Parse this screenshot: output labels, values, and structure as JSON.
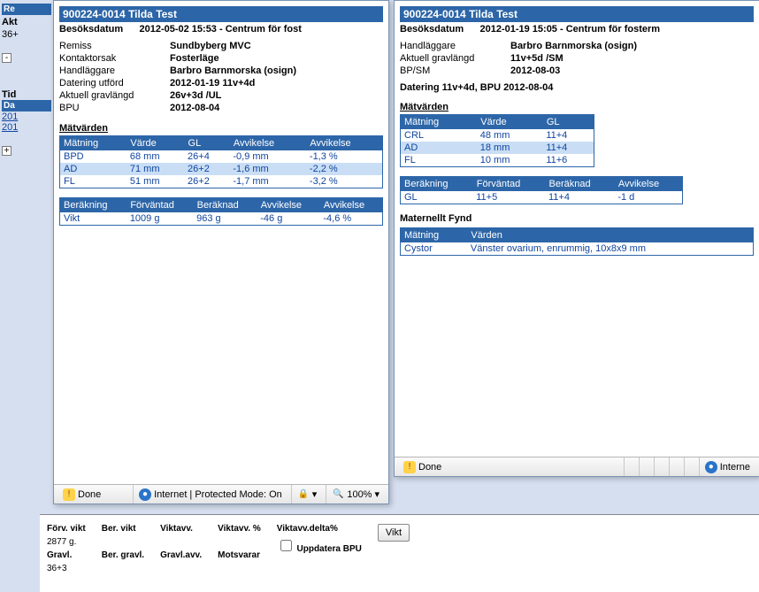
{
  "bg": {
    "re_label": "Re",
    "akt_label": "Akt",
    "akt_value": "36+",
    "tid_label": "Tid",
    "dat_label": "Da",
    "dates": [
      "201",
      "201"
    ]
  },
  "bottom": {
    "forv_vikt_lbl": "Förv. vikt",
    "forv_vikt_val": "2877 g.",
    "ber_vikt_lbl": "Ber. vikt",
    "viktavv_lbl": "Viktavv.",
    "viktavv_pct_lbl": "Viktavv. %",
    "viktavv_delta_lbl": "Viktavv.delta%",
    "gravl_lbl": "Gravl.",
    "gravl_val": "36+3",
    "ber_gravl_lbl": "Ber. gravl.",
    "gravlavv_lbl": "Gravl.avv.",
    "motsvarar_lbl": "Motsvarar",
    "uppdat_lbl": "Uppdatera BPU",
    "vikt_btn": "Vikt"
  },
  "left": {
    "title": "900224-0014 Tilda Test",
    "sub": "Besöksdatum      2012-05-02 15:53 - Centrum för fost",
    "kv": {
      "remiss_l": "Remiss",
      "remiss_v": "Sundbyberg MVC",
      "kontakt_l": "Kontaktorsak",
      "kontakt_v": "Fosterläge",
      "handl_l": "Handläggare",
      "handl_v": "Barbro Barnmorska (osign)",
      "datering_l": "Datering utförd",
      "datering_v": "2012-01-19 11v+4d",
      "akt_l": "Aktuell gravlängd",
      "akt_v": "26v+3d /UL",
      "bpu_l": "BPU",
      "bpu_v": "2012-08-04"
    },
    "matv_label": "Mätvärden",
    "matv_headers": [
      "Mätning",
      "Värde",
      "GL",
      "Avvikelse",
      "Avvikelse"
    ],
    "matv_rows": [
      {
        "m": "BPD",
        "v": "68 mm",
        "g": "26+4",
        "a": "-0,9 mm",
        "p": "-1,3 %",
        "sel": false
      },
      {
        "m": "AD",
        "v": "71 mm",
        "g": "26+2",
        "a": "-1,6 mm",
        "p": "-2,2 %",
        "sel": true
      },
      {
        "m": "FL",
        "v": "51 mm",
        "g": "26+2",
        "a": "-1,7 mm",
        "p": "-3,2 %",
        "sel": false
      }
    ],
    "calc_headers": [
      "Beräkning",
      "Förväntad",
      "Beräknad",
      "Avvikelse",
      "Avvikelse"
    ],
    "calc_rows": [
      {
        "b": "Vikt",
        "f": "1009 g",
        "c": "963 g",
        "a": "-46 g",
        "p": "-4,6 %"
      }
    ],
    "status_done": "Done",
    "status_zone": "Internet | Protected Mode: On",
    "status_zoom": "100%"
  },
  "right": {
    "title": "900224-0014 Tilda Test",
    "sub": "Besöksdatum      2012-01-19 15:05 - Centrum för fosterm",
    "kv": {
      "handl_l": "Handläggare",
      "handl_v": "Barbro Barnmorska (osign)",
      "akt_l": "Aktuell gravlängd",
      "akt_v": "11v+5d /SM",
      "bpsm_l": "BP/SM",
      "bpsm_v": "2012-08-03"
    },
    "dat_line": "Datering 11v+4d, BPU 2012-08-04",
    "matv_label": "Mätvärden",
    "matv_headers": [
      "Mätning",
      "Värde",
      "GL"
    ],
    "matv_rows": [
      {
        "m": "CRL",
        "v": "48 mm",
        "g": "11+4",
        "sel": false
      },
      {
        "m": "AD",
        "v": "18 mm",
        "g": "11+4",
        "sel": true
      },
      {
        "m": "FL",
        "v": "10 mm",
        "g": "11+6",
        "sel": false
      }
    ],
    "calc_headers": [
      "Beräkning",
      "Förväntad",
      "Beräknad",
      "Avvikelse"
    ],
    "calc_rows": [
      {
        "b": "GL",
        "f": "11+5",
        "c": "11+4",
        "a": "-1 d"
      }
    ],
    "mat_fynd_label": "Maternellt Fynd",
    "mf_headers": [
      "Mätning",
      "Värden"
    ],
    "mf_rows": [
      {
        "m": "Cystor",
        "v": "Vänster ovarium, enrummig, 10x8x9 mm"
      }
    ],
    "status_done": "Done",
    "status_zone": "Interne"
  }
}
